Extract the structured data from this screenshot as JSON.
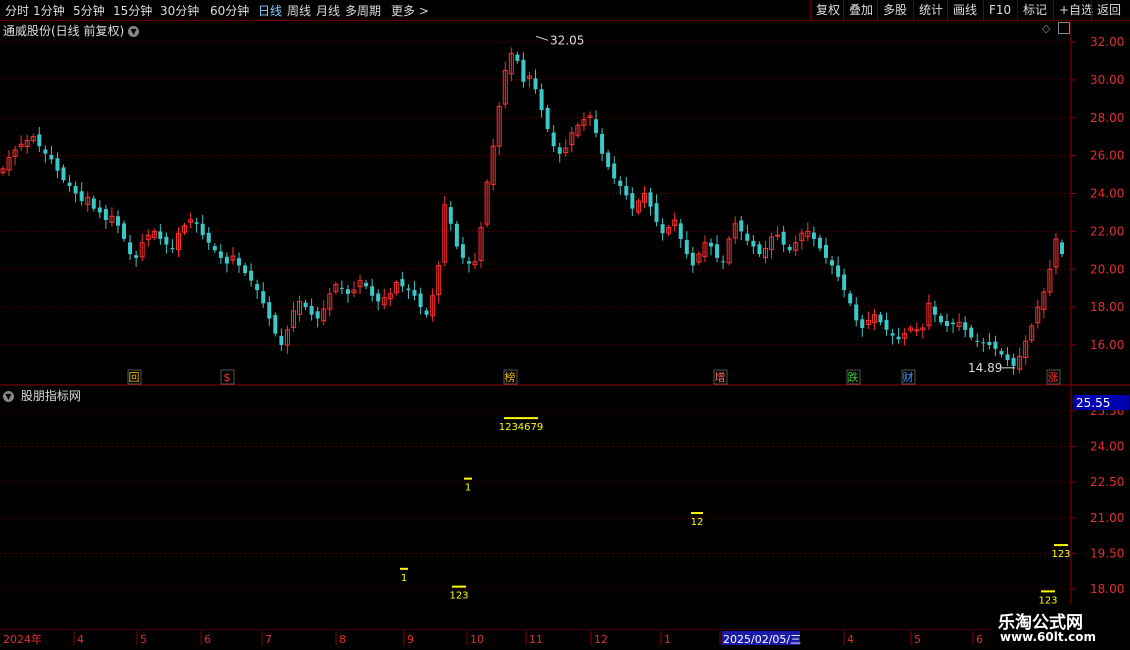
{
  "toolbar": {
    "timeframes": [
      "分时",
      "1分钟",
      "5分钟",
      "15分钟",
      "30分钟",
      "60分钟",
      "日线",
      "周线",
      "月线",
      "多周期",
      "更多 >"
    ],
    "active": "日线",
    "right_buttons": [
      "复权",
      "叠加",
      "多股",
      "统计",
      "画线",
      "F10",
      "标记",
      "+自选",
      "返回"
    ]
  },
  "main_panel": {
    "title": "通威股份(日线 前复权)",
    "high_label": "32.05",
    "low_label": "14.89",
    "y_ticks": [
      "32.00",
      "30.00",
      "28.00",
      "26.00",
      "24.00",
      "22.00",
      "20.00",
      "18.00",
      "16.00"
    ],
    "events": [
      {
        "text": "回",
        "color": "#e6b800"
      },
      {
        "text": "$",
        "color": "#ff3333"
      },
      {
        "text": "榜",
        "color": "#e6b800"
      },
      {
        "text": "增",
        "color": "#ff6666"
      },
      {
        "text": "跌",
        "color": "#33cc33"
      },
      {
        "text": "财",
        "color": "#3399ff"
      },
      {
        "text": "涨",
        "color": "#ff3333"
      }
    ]
  },
  "indicator_panel": {
    "title": "股朋指标网",
    "current_value": "25.55",
    "y_ticks": [
      "25.50",
      "24.00",
      "22.50",
      "21.00",
      "19.50",
      "18.00"
    ],
    "marks": [
      {
        "label": "1",
        "value": 18.85
      },
      {
        "label": "123",
        "value": 18.1
      },
      {
        "label": "1",
        "value": 22.65
      },
      {
        "label": "1234679",
        "value": 25.2
      },
      {
        "label": "12",
        "value": 21.2
      },
      {
        "label": "123",
        "value": 19.85
      },
      {
        "label": "123",
        "value": 17.9
      }
    ]
  },
  "time_axis": {
    "labels": [
      "2024年",
      "4",
      "5",
      "6",
      "7",
      "8",
      "9",
      "10",
      "11",
      "12",
      "1",
      "2025/02/05/三",
      "4",
      "5",
      "6"
    ]
  },
  "watermark": {
    "line1": "乐淘公式网",
    "line2": "www.60lt.com"
  },
  "chart_data": {
    "type": "candlestick",
    "title": "通威股份(日线 前复权)",
    "ylim": [
      14.5,
      32.5
    ],
    "x_months": [
      "2024年",
      "4",
      "5",
      "6",
      "7",
      "8",
      "9",
      "10",
      "11",
      "12",
      "1",
      "2025/02/05/三",
      "4",
      "5",
      "6"
    ],
    "close": [
      25.3,
      25.9,
      26.3,
      26.6,
      26.8,
      27.0,
      26.5,
      26.1,
      25.8,
      25.2,
      24.7,
      24.4,
      24.0,
      23.6,
      23.8,
      23.2,
      23.0,
      22.6,
      22.8,
      22.3,
      21.6,
      20.8,
      20.6,
      21.4,
      21.8,
      22.0,
      21.6,
      21.3,
      21.1,
      21.9,
      22.3,
      22.6,
      22.4,
      21.8,
      21.4,
      21.0,
      20.6,
      20.3,
      20.7,
      20.2,
      19.8,
      19.4,
      18.9,
      18.2,
      17.4,
      16.6,
      16.0,
      16.8,
      17.8,
      18.3,
      18.0,
      17.6,
      17.4,
      17.9,
      18.7,
      19.2,
      19.0,
      18.7,
      18.9,
      19.4,
      19.1,
      18.6,
      18.3,
      18.5,
      18.7,
      19.3,
      19.1,
      18.9,
      18.6,
      18.0,
      17.6,
      18.6,
      20.2,
      23.4,
      22.4,
      21.2,
      20.6,
      20.3,
      20.4,
      22.2,
      24.6,
      26.5,
      28.6,
      30.5,
      31.4,
      31.0,
      29.9,
      30.2,
      29.5,
      28.4,
      27.4,
      26.5,
      26.1,
      26.4,
      27.2,
      27.6,
      27.9,
      28.1,
      27.2,
      26.1,
      25.4,
      24.8,
      24.4,
      23.9,
      23.2,
      23.6,
      24.0,
      23.3,
      22.5,
      21.9,
      22.2,
      22.6,
      21.6,
      20.8,
      20.2,
      20.8,
      21.4,
      21.2,
      20.6,
      20.4,
      21.6,
      22.4,
      22.0,
      21.5,
      21.2,
      20.8,
      21.1,
      21.7,
      21.8,
      21.3,
      21.0,
      21.4,
      21.9,
      22.0,
      21.6,
      21.1,
      20.6,
      20.2,
      19.6,
      18.9,
      18.2,
      17.3,
      16.9,
      17.3,
      17.6,
      17.2,
      16.8,
      16.5,
      16.3,
      16.6,
      16.9,
      16.8,
      16.9,
      18.2,
      17.6,
      17.2,
      17.0,
      17.1,
      17.2,
      16.8,
      16.4,
      16.2,
      16.1,
      16.0,
      15.8,
      15.5,
      15.2,
      14.9,
      15.4,
      16.2,
      17.0,
      18.0,
      18.8,
      20.0,
      21.6,
      20.8
    ]
  }
}
